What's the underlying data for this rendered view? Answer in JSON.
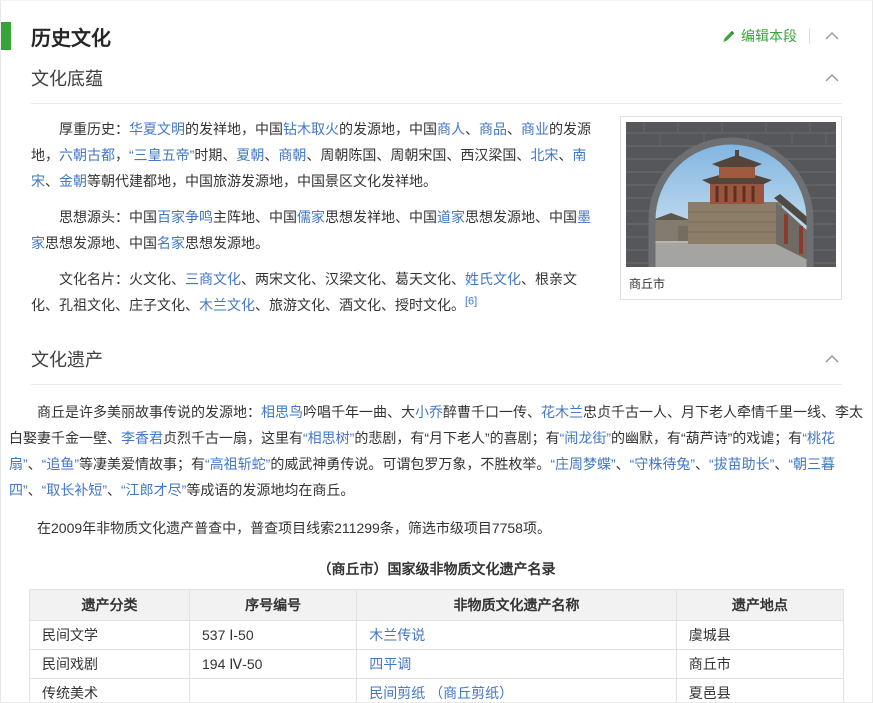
{
  "colors": {
    "accent_green": "#36a436",
    "link_blue": "#4277c4",
    "text": "#333333",
    "border": "#e5e5e5",
    "table_header_bg": "#f2f2f2"
  },
  "header": {
    "title": "历史文化",
    "edit_label": "编辑本段"
  },
  "section_culture": {
    "title": "文化底蕴",
    "photo_caption": "商丘市",
    "paragraphs": {
      "p1": [
        {
          "t": "厚重历史："
        },
        {
          "t": "华夏文明",
          "type": "link"
        },
        {
          "t": "的发祥地，中国"
        },
        {
          "t": "钻木取火",
          "type": "link"
        },
        {
          "t": "的发源地，中国"
        },
        {
          "t": "商人",
          "type": "link"
        },
        {
          "t": "、"
        },
        {
          "t": "商品",
          "type": "link"
        },
        {
          "t": "、"
        },
        {
          "t": "商业",
          "type": "link"
        },
        {
          "t": "的发源地，"
        },
        {
          "t": "六朝古都",
          "type": "link"
        },
        {
          "t": "，"
        },
        {
          "t": "“三皇五帝”",
          "type": "link"
        },
        {
          "t": "时期、"
        },
        {
          "t": "夏朝",
          "type": "link"
        },
        {
          "t": "、"
        },
        {
          "t": "商朝",
          "type": "link"
        },
        {
          "t": "、周朝陈国、周朝宋国、西汉梁国、"
        },
        {
          "t": "北宋",
          "type": "link"
        },
        {
          "t": "、"
        },
        {
          "t": "南宋",
          "type": "link"
        },
        {
          "t": "、"
        },
        {
          "t": "金朝",
          "type": "link"
        },
        {
          "t": "等朝代建都地，中国旅游发源地，中国景区文化发祥地。"
        }
      ],
      "p2": [
        {
          "t": "思想源头：中国"
        },
        {
          "t": "百家争鸣",
          "type": "link"
        },
        {
          "t": "主阵地、中国"
        },
        {
          "t": "儒家",
          "type": "link"
        },
        {
          "t": "思想发祥地、中国"
        },
        {
          "t": "道家",
          "type": "link"
        },
        {
          "t": "思想发源地、中国"
        },
        {
          "t": "墨家",
          "type": "link"
        },
        {
          "t": "思想发源地、中国"
        },
        {
          "t": "名家",
          "type": "link"
        },
        {
          "t": "思想发源地。"
        }
      ],
      "p3": [
        {
          "t": "文化名片：火文化、"
        },
        {
          "t": "三商文化",
          "type": "link"
        },
        {
          "t": "、两宋文化、汉梁文化、葛天文化、"
        },
        {
          "t": "姓氏文化",
          "type": "link"
        },
        {
          "t": "、根亲文化、孔祖文化、庄子文化、"
        },
        {
          "t": "木兰文化",
          "type": "link"
        },
        {
          "t": "、旅游文化、酒文化、授时文化。"
        },
        {
          "t": "[6]",
          "type": "sup"
        }
      ]
    }
  },
  "section_heritage": {
    "title": "文化遗产",
    "paragraphs": {
      "p1": [
        {
          "t": "商丘是许多美丽故事传说的发源地："
        },
        {
          "t": "相思鸟",
          "type": "link"
        },
        {
          "t": "吟唱千年一曲、大"
        },
        {
          "t": "小乔",
          "type": "link"
        },
        {
          "t": "醉曹千口一传、"
        },
        {
          "t": "花木兰",
          "type": "link"
        },
        {
          "t": "忠贞千古一人、月下老人牵情千里一线、李太白娶妻千金一壁、"
        },
        {
          "t": "李香君",
          "type": "link"
        },
        {
          "t": "贞烈千古一扇，这里有"
        },
        {
          "t": "“相思树”",
          "type": "link"
        },
        {
          "t": "的悲剧，有“月下老人”的喜剧；有"
        },
        {
          "t": "“闹龙街”",
          "type": "link"
        },
        {
          "t": "的幽默，有“葫芦诗”的戏谑；有"
        },
        {
          "t": "“桃花扇”",
          "type": "link"
        },
        {
          "t": "、"
        },
        {
          "t": "“追鱼”",
          "type": "link"
        },
        {
          "t": "等凄美爱情故事；有"
        },
        {
          "t": "“高祖斩蛇”",
          "type": "link"
        },
        {
          "t": "的威武神勇传说。可谓包罗万象，不胜枚举。"
        },
        {
          "t": "“庄周梦蝶”",
          "type": "link"
        },
        {
          "t": "、"
        },
        {
          "t": "“守株待兔”",
          "type": "link"
        },
        {
          "t": "、"
        },
        {
          "t": "“拔苗助长”",
          "type": "link"
        },
        {
          "t": "、"
        },
        {
          "t": "“朝三暮四”",
          "type": "link"
        },
        {
          "t": "、"
        },
        {
          "t": "“取长补短”",
          "type": "link"
        },
        {
          "t": "、"
        },
        {
          "t": "“江郎才尽”",
          "type": "link"
        },
        {
          "t": "等成语的发源地均在商丘。"
        }
      ],
      "p2": [
        {
          "t": "在2009年非物质文化遗产普查中，普查项目线索211299条，筛选市级项目7758项。"
        }
      ]
    },
    "table_caption": "（商丘市）国家级非物质文化遗产名录",
    "table": {
      "headers": [
        "遗产分类",
        "序号编号",
        "非物质文化遗产名称",
        "遗产地点"
      ],
      "rows": [
        {
          "category": "民间文学",
          "number": "537 Ⅰ-50",
          "name": "木兰传说",
          "name_is_link": true,
          "location": "虞城县"
        },
        {
          "category": "民间戏剧",
          "number": "194 Ⅳ-50",
          "name": "四平调",
          "name_is_link": true,
          "location": "商丘市"
        },
        {
          "category": "传统美术",
          "number": "",
          "name": "民间剪纸 （商丘剪纸）",
          "name_is_link": true,
          "location": "夏邑县"
        }
      ]
    }
  }
}
